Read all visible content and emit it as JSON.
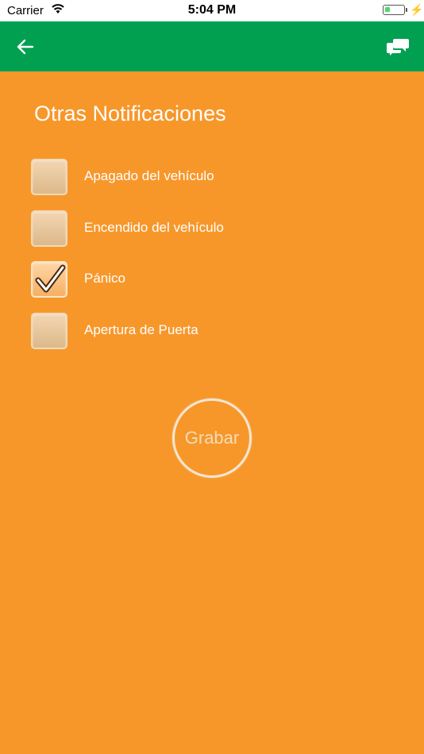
{
  "statusbar": {
    "carrier": "Carrier",
    "time": "5:04 PM",
    "battery_color": "#4cd964"
  },
  "navbar": {
    "background": "#00a050",
    "back_icon": "arrow-left-icon",
    "chat_icon": "chat-bubbles-icon"
  },
  "page": {
    "title": "Otras Notificaciones",
    "background": "#f7972a"
  },
  "options": [
    {
      "label": "Apagado del vehículo",
      "checked": false
    },
    {
      "label": "Encendido del vehículo",
      "checked": false
    },
    {
      "label": "Pánico",
      "checked": true
    },
    {
      "label": "Apertura de Puerta",
      "checked": false
    }
  ],
  "save_button": {
    "label": "Grabar"
  }
}
